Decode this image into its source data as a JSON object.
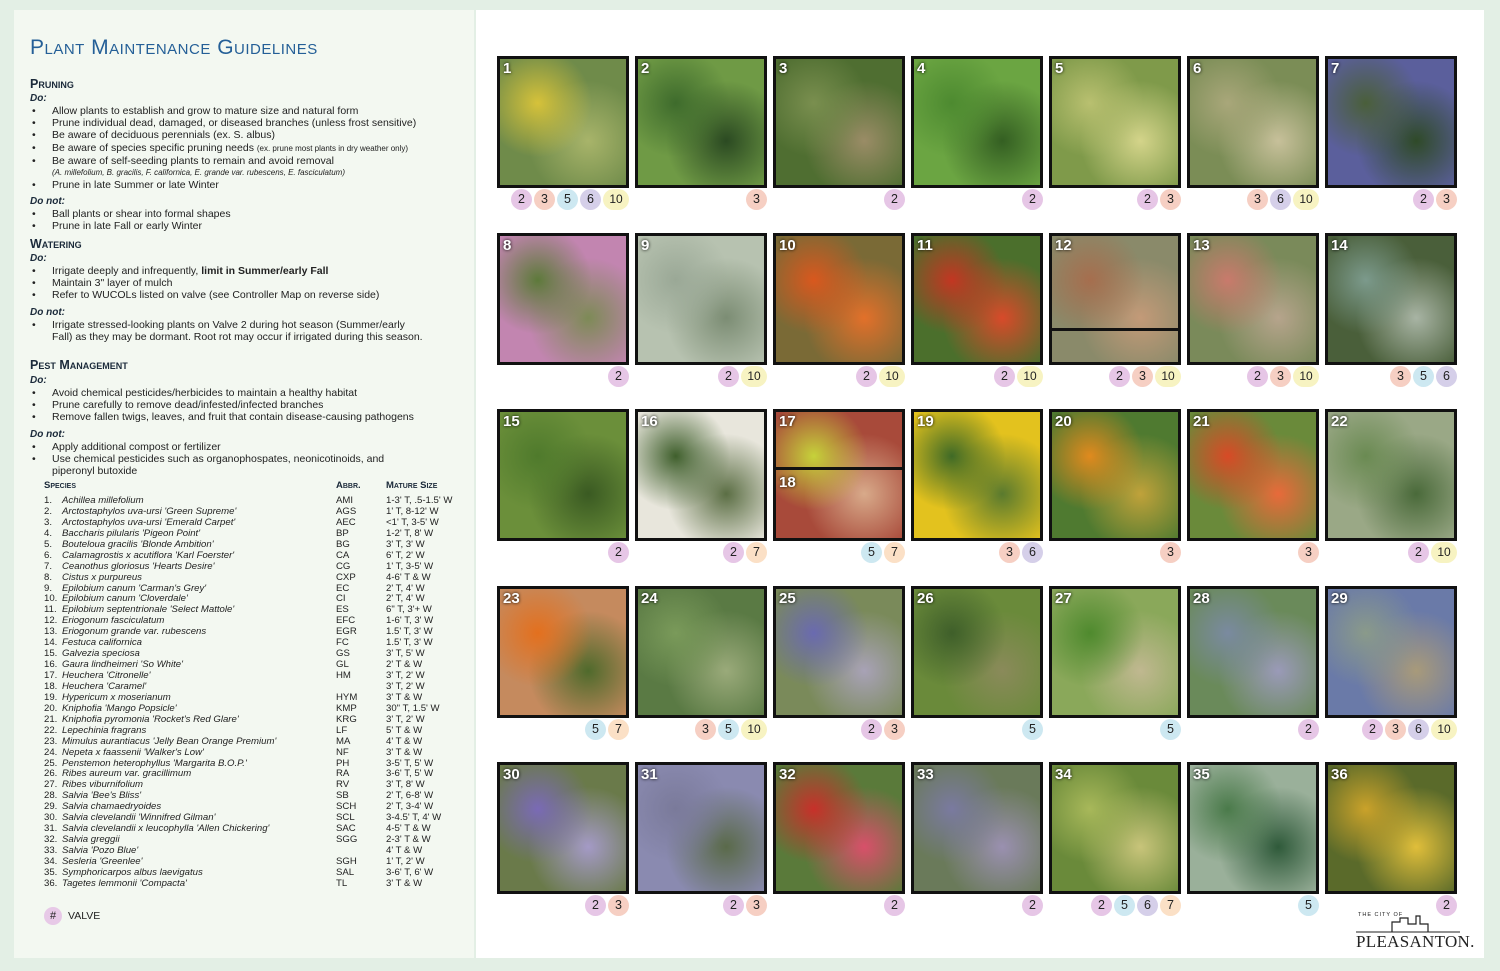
{
  "title": "Plant Maintenance Guidelines",
  "pruning": {
    "heading": "Pruning",
    "do_label": "Do:",
    "do": [
      "Allow plants to establish and grow to mature size and natural form",
      "Prune individual dead, damaged, or diseased branches (unless frost sensitive)",
      "Be aware of deciduous perennials (ex. S. albus)",
      "Be aware of species specific pruning needs",
      "Be aware of self-seeding plants to remain and avoid removal",
      "Prune in late Summer or late Winter"
    ],
    "do_small_note": "(ex. prune most plants in dry weather only)",
    "do_species_note": "(A. millefolium, B. gracilis, F. californica, E. grande var. rubescens, E. fasciculatum)",
    "donot_label": "Do not:",
    "donot": [
      "Ball plants or shear into formal shapes",
      "Prune in late Fall or early Winter"
    ]
  },
  "watering": {
    "heading": "Watering",
    "do_label": "Do:",
    "do": [
      "Irrigate deeply and infrequently, ",
      "Maintain 3\" layer of mulch",
      "Refer to WUCOLs listed on valve (see Controller Map on reverse side)"
    ],
    "do_bold": "limit in Summer/early Fall",
    "donot_label": "Do not:",
    "donot": [
      "Irrigate stressed-looking plants on Valve 2 during hot season (Summer/early",
      "Fall) as they may be dormant. Root rot may occur if irrigated during this season."
    ]
  },
  "pest": {
    "heading": "Pest Management",
    "do_label": "Do:",
    "do": [
      "Avoid chemical pesticides/herbicides to maintain a healthy habitat",
      "Prune carefully to remove dead/infested/infected branches",
      "Remove fallen twigs, leaves, and fruit that contain disease-causing pathogens"
    ],
    "donot_label": "Do not:",
    "donot": [
      "Apply additional compost or fertilizer",
      "Use chemical pesticides such as organophospates, neonicotinoids, and",
      "piperonyl butoxide"
    ]
  },
  "table": {
    "h_species": "Species",
    "h_abbr": "Abbr.",
    "h_size": "Mature Size",
    "rows": [
      {
        "n": "1.",
        "name": "Achillea millefolium",
        "abbr": "AMI",
        "size": "1-3' T, .5-1.5' W"
      },
      {
        "n": "2.",
        "name": "Arctostaphylos uva-ursi 'Green Supreme'",
        "abbr": "AGS",
        "size": "1' T, 8-12' W"
      },
      {
        "n": "3.",
        "name": "Arctostaphylos uva-ursi 'Emerald Carpet'",
        "abbr": "AEC",
        "size": "<1' T, 3-5' W"
      },
      {
        "n": "4.",
        "name": "Baccharis pilularis 'Pigeon Point'",
        "abbr": "BP",
        "size": "1-2' T, 8' W"
      },
      {
        "n": "5.",
        "name": "Bouteloua gracilis 'Blonde Ambition'",
        "abbr": "BG",
        "size": "3' T, 3' W"
      },
      {
        "n": "6.",
        "name": "Calamagrostis x acutiflora 'Karl Foerster'",
        "abbr": "CA",
        "size": "6' T, 2' W"
      },
      {
        "n": "7.",
        "name": "Ceanothus gloriosus 'Hearts Desire'",
        "abbr": "CG",
        "size": "1' T, 3-5' W"
      },
      {
        "n": "8.",
        "name": "Cistus x purpureus",
        "abbr": "CXP",
        "size": "4-6' T & W"
      },
      {
        "n": "9.",
        "name": "Epilobium canum 'Carman's Grey'",
        "abbr": "EC",
        "size": "2' T, 4' W"
      },
      {
        "n": "10.",
        "name": "Epilobium canum 'Cloverdale'",
        "abbr": "CI",
        "size": "2' T, 4' W"
      },
      {
        "n": "11.",
        "name": "Epilobium septentrionale 'Select Mattole'",
        "abbr": "ES",
        "size": "6\" T, 3'+ W"
      },
      {
        "n": "12.",
        "name": "Eriogonum fasciculatum",
        "abbr": "EFC",
        "size": "1-6' T, 3' W"
      },
      {
        "n": "13.",
        "name": "Eriogonum grande var. rubescens",
        "abbr": "EGR",
        "size": "1.5' T, 3' W"
      },
      {
        "n": "14.",
        "name": "Festuca californica",
        "abbr": "FC",
        "size": "1.5' T, 3' W"
      },
      {
        "n": "15.",
        "name": "Galvezia speciosa",
        "abbr": "GS",
        "size": "3' T, 5' W"
      },
      {
        "n": "16.",
        "name": "Gaura lindheimeri 'So White'",
        "abbr": "GL",
        "size": "2' T & W"
      },
      {
        "n": "17.",
        "name": "Heuchera 'Citronelle'",
        "abbr": "HM",
        "size": "3' T, 2' W"
      },
      {
        "n": "18.",
        "name": "Heuchera 'Caramel'",
        "abbr": "",
        "size": "3' T, 2' W"
      },
      {
        "n": "19.",
        "name": "Hypericum x moserianum",
        "abbr": "HYM",
        "size": "3' T & W"
      },
      {
        "n": "20.",
        "name": "Kniphofia 'Mango Popsicle'",
        "abbr": "KMP",
        "size": "30\" T, 1.5' W"
      },
      {
        "n": "21.",
        "name": "Kniphofia pyromonia 'Rocket's Red Glare'",
        "abbr": "KRG",
        "size": "3' T, 2' W"
      },
      {
        "n": "22.",
        "name": "Lepechinia fragrans",
        "abbr": "LF",
        "size": "5' T & W"
      },
      {
        "n": "23.",
        "name": "Mimulus aurantiacus 'Jelly Bean Orange Premium'",
        "abbr": "MA",
        "size": "4' T & W"
      },
      {
        "n": "24.",
        "name": "Nepeta x faassenii 'Walker's Low'",
        "abbr": "NF",
        "size": "3' T & W"
      },
      {
        "n": "25.",
        "name": "Penstemon heterophyllus 'Margarita B.O.P.'",
        "abbr": "PH",
        "size": "3-5' T, 5' W"
      },
      {
        "n": "26.",
        "name": "Ribes aureum var. gracillimum",
        "abbr": "RA",
        "size": "3-6' T, 5' W"
      },
      {
        "n": "27.",
        "name": "Ribes viburnifolium",
        "abbr": "RV",
        "size": "3' T, 8' W"
      },
      {
        "n": "28.",
        "name": "Salvia 'Bee's Bliss'",
        "abbr": "SB",
        "size": "2' T, 6-8' W"
      },
      {
        "n": "29.",
        "name": "Salvia chamaedryoides",
        "abbr": "SCH",
        "size": "2' T, 3-4' W"
      },
      {
        "n": "30.",
        "name": "Salvia clevelandii 'Winnifred Gilman'",
        "abbr": "SCL",
        "size": "3-4.5' T, 4' W"
      },
      {
        "n": "31.",
        "name": "Salvia clevelandii x leucophylla 'Allen Chickering'",
        "abbr": "SAC",
        "size": "4-5' T & W"
      },
      {
        "n": "32.",
        "name": "Salvia greggii",
        "abbr": "SGG",
        "size": "2-3' T & W"
      },
      {
        "n": "33.",
        "name": "Salvia 'Pozo Blue'",
        "abbr": "",
        "size": "4' T & W"
      },
      {
        "n": "34.",
        "name": "Sesleria 'Greenlee'",
        "abbr": "SGH",
        "size": "1' T, 2' W"
      },
      {
        "n": "35.",
        "name": "Symphoricarpos albus laevigatus",
        "abbr": "SAL",
        "size": "3-6' T, 6' W"
      },
      {
        "n": "36.",
        "name": "Tagetes lemmonii 'Compacta'",
        "abbr": "TL",
        "size": "3' T & W"
      }
    ]
  },
  "valve_key": {
    "symbol": "#",
    "label": "VALVE"
  },
  "valve_colors": {
    "2": "#e6c6e6",
    "3": "#f6cfc3",
    "5": "#cde8f1",
    "6": "#d5cfe9",
    "7": "#fbe0c6",
    "10": "#f7f3c2"
  },
  "tiles": [
    {
      "num": "1",
      "valves": [
        "2",
        "3",
        "5",
        "6",
        "10"
      ],
      "photo": [
        "#d6c23a",
        "#6f8b4a",
        "#a8b46a"
      ]
    },
    {
      "num": "2",
      "valves": [
        "3"
      ],
      "photo": [
        "#3e6b2c",
        "#6f9a45",
        "#2b4a22"
      ]
    },
    {
      "num": "3",
      "valves": [
        "2"
      ],
      "photo": [
        "#7a8f4f",
        "#4f6e31",
        "#9a8c66"
      ]
    },
    {
      "num": "4",
      "valves": [
        "2"
      ],
      "photo": [
        "#4d8a30",
        "#6ba542",
        "#345f22"
      ]
    },
    {
      "num": "5",
      "valves": [
        "2",
        "3"
      ],
      "photo": [
        "#b9c070",
        "#7f9a4a",
        "#d4d48a"
      ]
    },
    {
      "num": "6",
      "valves": [
        "3",
        "6",
        "10"
      ],
      "photo": [
        "#a9a77a",
        "#7b8d56",
        "#c7c09a"
      ]
    },
    {
      "num": "7",
      "valves": [
        "2",
        "3"
      ],
      "photo": [
        "#4a5f3a",
        "#5b5f9c",
        "#2f4a28"
      ]
    },
    {
      "num": "8",
      "valves": [
        "2"
      ],
      "photo": [
        "#5d7a3a",
        "#c285b0",
        "#7d8a56"
      ]
    },
    {
      "num": "9",
      "valves": [
        "2",
        "10"
      ],
      "photo": [
        "#9aa896",
        "#b7c2b0",
        "#7c8d74"
      ]
    },
    {
      "num": "10",
      "valves": [
        "2",
        "10"
      ],
      "photo": [
        "#d9581e",
        "#7a6a36",
        "#e2702a"
      ]
    },
    {
      "num": "11",
      "valves": [
        "2",
        "10"
      ],
      "photo": [
        "#c33622",
        "#4b6f2c",
        "#d84a2a"
      ]
    },
    {
      "num": "12",
      "valves": [
        "2",
        "3",
        "10"
      ],
      "photo": [
        "#a66e4e",
        "#8a8a6a",
        "#c39a78"
      ],
      "split": true
    },
    {
      "num": "13",
      "valves": [
        "2",
        "3",
        "10"
      ],
      "photo": [
        "#c97a6c",
        "#7a8a5a",
        "#b6a48c"
      ]
    },
    {
      "num": "14",
      "valves": [
        "3",
        "5",
        "6"
      ],
      "photo": [
        "#7c9a8c",
        "#4a5f3a",
        "#a8b4a4"
      ]
    },
    {
      "num": "15",
      "valves": [
        "2"
      ],
      "photo": [
        "#4f7a2c",
        "#6b8f3a",
        "#3a5a22"
      ]
    },
    {
      "num": "16",
      "valves": [
        "2",
        "7"
      ],
      "photo": [
        "#3f5f2c",
        "#e8e6dc",
        "#5b6e44"
      ]
    },
    {
      "num": "17",
      "num2": "18",
      "valves": [
        "5",
        "7"
      ],
      "photo": [
        "#c6d23a",
        "#a84a3a",
        "#d8aa8a"
      ],
      "split": true
    },
    {
      "num": "19",
      "valves": [
        "3",
        "6"
      ],
      "photo": [
        "#3f6a26",
        "#e3c21e",
        "#5a7a2e"
      ]
    },
    {
      "num": "20",
      "valves": [
        "3"
      ],
      "photo": [
        "#e08a1e",
        "#4f7a30",
        "#c0a23a"
      ]
    },
    {
      "num": "21",
      "valves": [
        "3"
      ],
      "photo": [
        "#d84a26",
        "#6a8a3a",
        "#e86a3a"
      ]
    },
    {
      "num": "22",
      "valves": [
        "2",
        "10"
      ],
      "photo": [
        "#6a8a52",
        "#9aa886",
        "#4a6a3a"
      ]
    },
    {
      "num": "23",
      "valves": [
        "5",
        "7"
      ],
      "photo": [
        "#e3701e",
        "#c58a5e",
        "#4f6a2c"
      ]
    },
    {
      "num": "24",
      "valves": [
        "3",
        "5",
        "10"
      ],
      "photo": [
        "#7a9a5a",
        "#5a7a44",
        "#9aaa7a"
      ]
    },
    {
      "num": "25",
      "valves": [
        "2",
        "3"
      ],
      "photo": [
        "#6a6ab0",
        "#7a8a5a",
        "#a8a2b6"
      ]
    },
    {
      "num": "26",
      "valves": [
        "5"
      ],
      "photo": [
        "#3f5f2a",
        "#6a8a3a",
        "#8a8a5a"
      ]
    },
    {
      "num": "27",
      "valves": [
        "5"
      ],
      "photo": [
        "#4f8a2e",
        "#8aa85a",
        "#c0b890"
      ]
    },
    {
      "num": "28",
      "valves": [
        "2"
      ],
      "photo": [
        "#7a8aa0",
        "#6a8a5a",
        "#9a9ab8"
      ]
    },
    {
      "num": "29",
      "valves": [
        "2",
        "3",
        "6",
        "10"
      ],
      "photo": [
        "#8a9a8a",
        "#6a7aa8",
        "#a89a7a"
      ]
    },
    {
      "num": "30",
      "valves": [
        "2",
        "3"
      ],
      "photo": [
        "#7a6ab6",
        "#6a7a4a",
        "#a49ac6"
      ]
    },
    {
      "num": "31",
      "valves": [
        "2",
        "3"
      ],
      "photo": [
        "#7a7a9a",
        "#8a8ab0",
        "#5a6a4a"
      ]
    },
    {
      "num": "32",
      "valves": [
        "2"
      ],
      "photo": [
        "#c8302a",
        "#5a7a3a",
        "#d8506a"
      ]
    },
    {
      "num": "33",
      "valves": [
        "2"
      ],
      "photo": [
        "#7a7aa0",
        "#6a7a5a",
        "#9a90b0"
      ]
    },
    {
      "num": "34",
      "valves": [
        "2",
        "5",
        "6",
        "7"
      ],
      "photo": [
        "#a8b85a",
        "#6a8a3a",
        "#c8c47a"
      ]
    },
    {
      "num": "35",
      "valves": [
        "5"
      ],
      "photo": [
        "#4a7a4a",
        "#9ab09a",
        "#2f5a3a"
      ]
    },
    {
      "num": "36",
      "valves": [
        "2"
      ],
      "photo": [
        "#caa22a",
        "#5a6a2a",
        "#e0be3a"
      ]
    }
  ],
  "logo": {
    "small": "THE CITY OF",
    "main": "PLEASANTON."
  }
}
